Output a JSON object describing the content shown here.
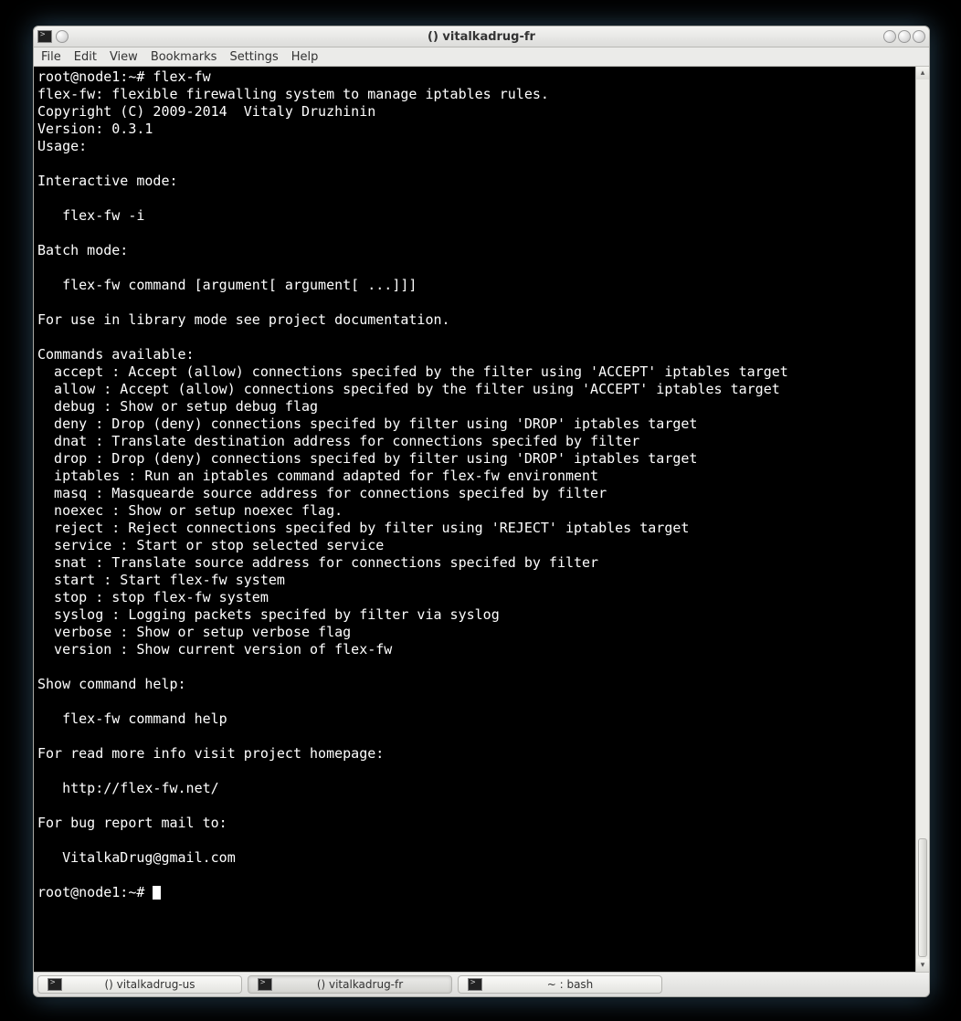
{
  "window_title": "() vitalkadrug-fr",
  "menu": {
    "file": "File",
    "edit": "Edit",
    "view": "View",
    "bookmarks": "Bookmarks",
    "settings": "Settings",
    "help": "Help"
  },
  "terminal": {
    "prompt1": "root@node1:~# ",
    "command1": "flex-fw",
    "lines": [
      "flex-fw: flexible firewalling system to manage iptables rules.",
      "Copyright (C) 2009-2014  Vitaly Druzhinin",
      "Version: 0.3.1",
      "Usage:",
      "",
      "Interactive mode:",
      "",
      "   flex-fw -i",
      "",
      "Batch mode:",
      "",
      "   flex-fw command [argument[ argument[ ...]]]",
      "",
      "For use in library mode see project documentation.",
      "",
      "Commands available:",
      "  accept : Accept (allow) connections specifed by the filter using 'ACCEPT' iptables target",
      "  allow : Accept (allow) connections specifed by the filter using 'ACCEPT' iptables target",
      "  debug : Show or setup debug flag",
      "  deny : Drop (deny) connections specifed by filter using 'DROP' iptables target",
      "  dnat : Translate destination address for connections specifed by filter",
      "  drop : Drop (deny) connections specifed by filter using 'DROP' iptables target",
      "  iptables : Run an iptables command adapted for flex-fw environment",
      "  masq : Masquearde source address for connections specifed by filter",
      "  noexec : Show or setup noexec flag.",
      "  reject : Reject connections specifed by filter using 'REJECT' iptables target",
      "  service : Start or stop selected service",
      "  snat : Translate source address for connections specifed by filter",
      "  start : Start flex-fw system",
      "  stop : stop flex-fw system",
      "  syslog : Logging packets specifed by filter via syslog",
      "  verbose : Show or setup verbose flag",
      "  version : Show current version of flex-fw",
      "",
      "Show command help:",
      "",
      "   flex-fw command help",
      "",
      "For read more info visit project homepage:",
      "",
      "   http://flex-fw.net/",
      "",
      "For bug report mail to:",
      "",
      "   VitalkaDrug@gmail.com",
      ""
    ],
    "prompt2": "root@node1:~# "
  },
  "taskbar": {
    "items": [
      {
        "label": "() vitalkadrug-us",
        "active": false
      },
      {
        "label": "() vitalkadrug-fr",
        "active": true
      },
      {
        "label": "~ : bash",
        "active": false
      }
    ]
  }
}
